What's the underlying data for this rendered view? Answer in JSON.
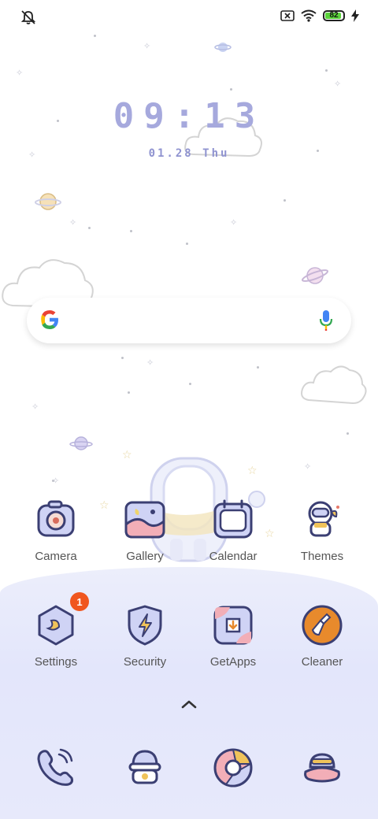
{
  "status_bar": {
    "left_icon": "bell-off-icon",
    "sim_icon": "sim-x-icon",
    "wifi_icon": "wifi-icon",
    "battery_level": "82",
    "charging_icon": "charging-bolt-icon"
  },
  "clock": {
    "time": "09:13",
    "date": "01.28 Thu"
  },
  "search": {
    "placeholder": "",
    "google_icon": "google-g-icon",
    "mic_icon": "microphone-icon"
  },
  "apps_row1": [
    {
      "label": "Camera",
      "icon": "camera-icon"
    },
    {
      "label": "Gallery",
      "icon": "gallery-icon"
    },
    {
      "label": "Calendar",
      "icon": "calendar-icon"
    },
    {
      "label": "Themes",
      "icon": "themes-icon"
    }
  ],
  "apps_row2": [
    {
      "label": "Settings",
      "icon": "settings-icon",
      "badge": "1"
    },
    {
      "label": "Security",
      "icon": "security-icon"
    },
    {
      "label": "GetApps",
      "icon": "getapps-icon"
    },
    {
      "label": "Cleaner",
      "icon": "cleaner-icon"
    }
  ],
  "drawer_icon": "chevron-up-icon",
  "dock": [
    {
      "icon": "phone-icon"
    },
    {
      "icon": "messages-icon"
    },
    {
      "icon": "browser-icon"
    },
    {
      "icon": "music-icon"
    }
  ],
  "colors": {
    "accent_lavender": "#a6a9dd",
    "icon_outline": "#3b3f73",
    "badge": "#f0561e",
    "cleaner_orange": "#e88a2c",
    "battery_green": "#5ad33a"
  }
}
